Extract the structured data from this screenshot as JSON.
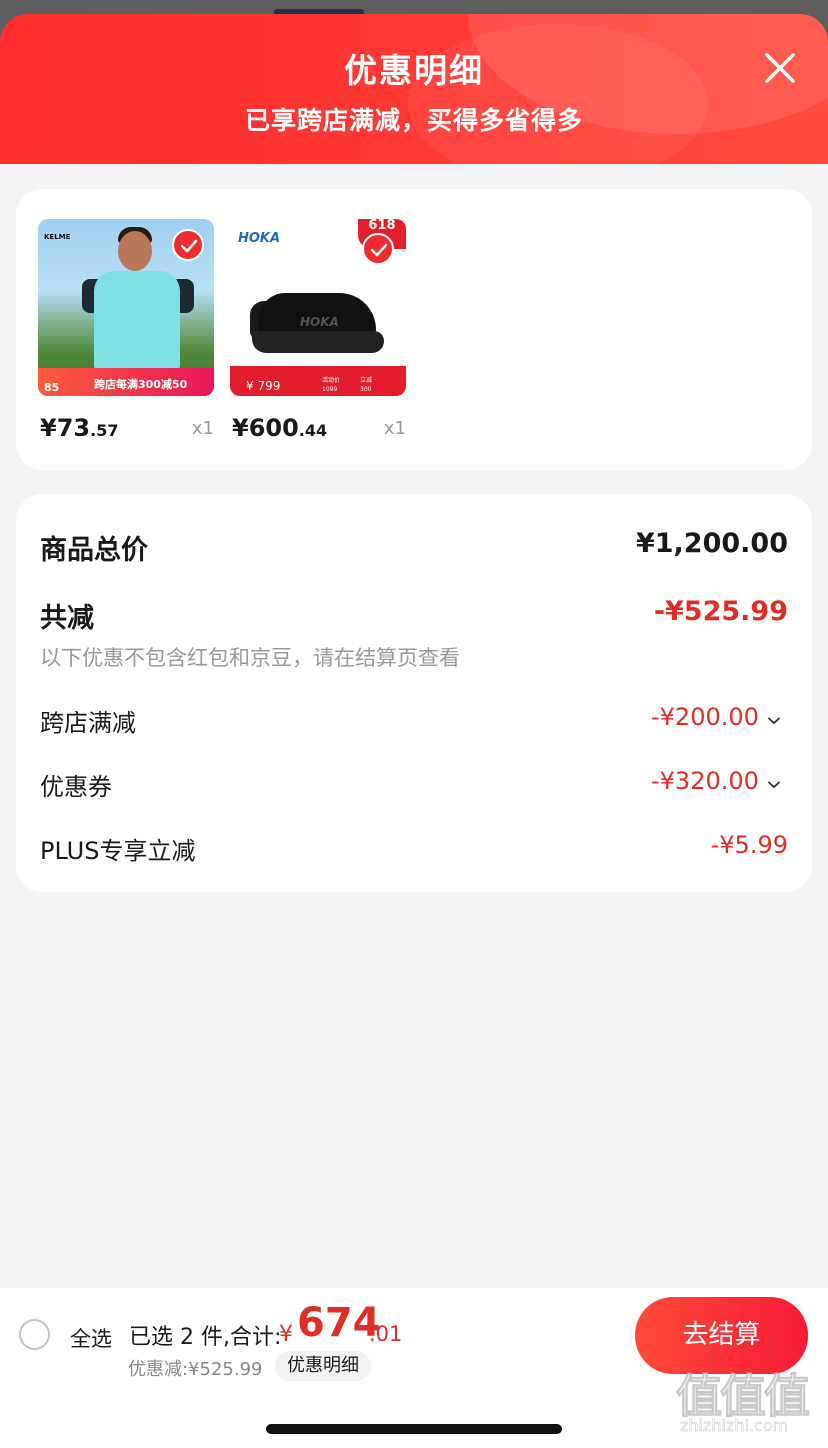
{
  "header": {
    "title": "优惠明细",
    "subtitle": "已享跨店满减，买得多省得多",
    "close_icon": "close-icon"
  },
  "products": [
    {
      "price_int": "¥73",
      "price_dec": ".57",
      "qty": "x1",
      "thumb_brand": "KELME",
      "thumb_banner": "跨店每满300减50",
      "thumb_price": "85"
    },
    {
      "price_int": "¥600",
      "price_dec": ".44",
      "qty": "x1",
      "thumb_brand": "HOKA",
      "thumb_badge": "618",
      "thumb_price": "¥ 799",
      "thumb_mini_1": "活动价",
      "thumb_mini_2": "1099",
      "thumb_mini_3": "立减",
      "thumb_mini_4": "300"
    }
  ],
  "summary": {
    "total_label": "商品总价",
    "total_value": "¥1,200.00",
    "reduce_label": "共减",
    "reduce_value": "-¥525.99",
    "note": "以下优惠不包含红包和京豆，请在结算页查看",
    "items": [
      {
        "label": "跨店满减",
        "value": "-¥200.00",
        "expandable": true
      },
      {
        "label": "优惠券",
        "value": "-¥320.00",
        "expandable": true
      },
      {
        "label": "PLUS专享立减",
        "value": "-¥5.99",
        "expandable": false
      }
    ]
  },
  "bottom": {
    "select_all": "全选",
    "selected_text": "已选 2 件,合计:",
    "total_symbol": "¥",
    "total_int": "674",
    "total_dec": ".01",
    "discount_note": "优惠减:¥525.99",
    "detail_label": "优惠明细",
    "checkout_label": "去结算"
  },
  "watermark": {
    "glyphs": "值值值",
    "url": "zhizhizhi.com"
  },
  "colors": {
    "accent_red": "#e02e24",
    "header_red": "#ff2d2d",
    "page_bg": "#f4f4f4"
  }
}
